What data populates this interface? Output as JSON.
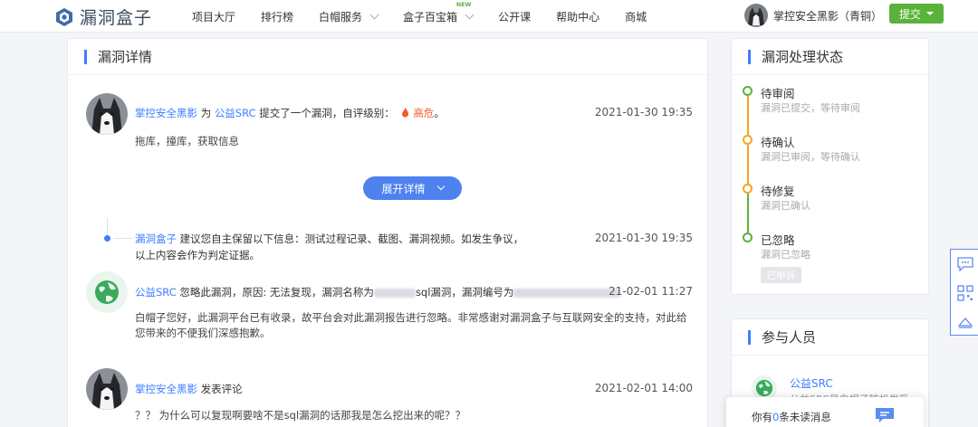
{
  "brand": {
    "name": "漏洞盒子"
  },
  "nav": [
    {
      "label": "项目大厅",
      "dropdown": false
    },
    {
      "label": "排行榜",
      "dropdown": false
    },
    {
      "label": "白帽服务",
      "dropdown": true
    },
    {
      "label": "盒子百宝箱",
      "dropdown": true,
      "badge": "NEW"
    },
    {
      "label": "公开课",
      "dropdown": false
    },
    {
      "label": "帮助中心",
      "dropdown": false
    },
    {
      "label": "商城",
      "dropdown": false
    }
  ],
  "user": {
    "name": "掌控安全黑影（青铜）",
    "submit_label": "提交"
  },
  "detail": {
    "title": "漏洞详情",
    "entry1": {
      "author": "掌控安全黑影",
      "w1": "为",
      "target": "公益SRC",
      "w2": "提交了一个漏洞，自评级别：",
      "level": "高危",
      "end": "。",
      "time": "2021-01-30 19:35",
      "body": "拖库，撞库，获取信息"
    },
    "expand_label": "展开详情",
    "system": {
      "author": "漏洞盒子",
      "text1": "建议您自主保留以下信息：测试过程记录、截图、漏洞视频。如发生争议，",
      "text2": "以上内容会作为判定证据。",
      "time": "2021-01-30 19:35"
    },
    "ignore": {
      "author": "公益SRC",
      "w1": "忽略此漏洞，原因: 无法复现，漏洞名称为",
      "w2": "sql漏洞，漏洞编号为",
      "time": "21-02-01 11:27",
      "body1": "白帽子您好，此漏洞平台已有收录，故平台会对此漏洞报告进行忽略。非常感谢对漏洞盒子与互联网安全的支持，对此给",
      "body2": "您带来的不便我们深感抱歉。"
    },
    "comment": {
      "author": "掌控安全黑影",
      "w1": "发表评论",
      "time": "2021-02-01 14:00",
      "body": "？？ 为什么可以复现啊要啥不是sql漏洞的话那我是怎么挖出来的呢？？"
    }
  },
  "status": {
    "title": "漏洞处理状态",
    "steps": [
      {
        "title": "待审阅",
        "sub": "漏洞已提交，等待审阅",
        "color": "#59b33a"
      },
      {
        "title": "待确认",
        "sub": "漏洞已审阅，等待确认",
        "color": "#f5a623"
      },
      {
        "title": "待修复",
        "sub": "漏洞已确认",
        "color": "#f5a623"
      },
      {
        "title": "已忽略",
        "sub": "漏洞已忽略",
        "color": "#59b33a"
      }
    ],
    "appeal_label": "已申诉"
  },
  "participants": {
    "title": "参与人员",
    "name": "公益SRC",
    "sub": "公益SRC是白帽子随机发现漏洞"
  },
  "message": {
    "prefix": "你有",
    "count": "0",
    "suffix": "条未读消息"
  }
}
